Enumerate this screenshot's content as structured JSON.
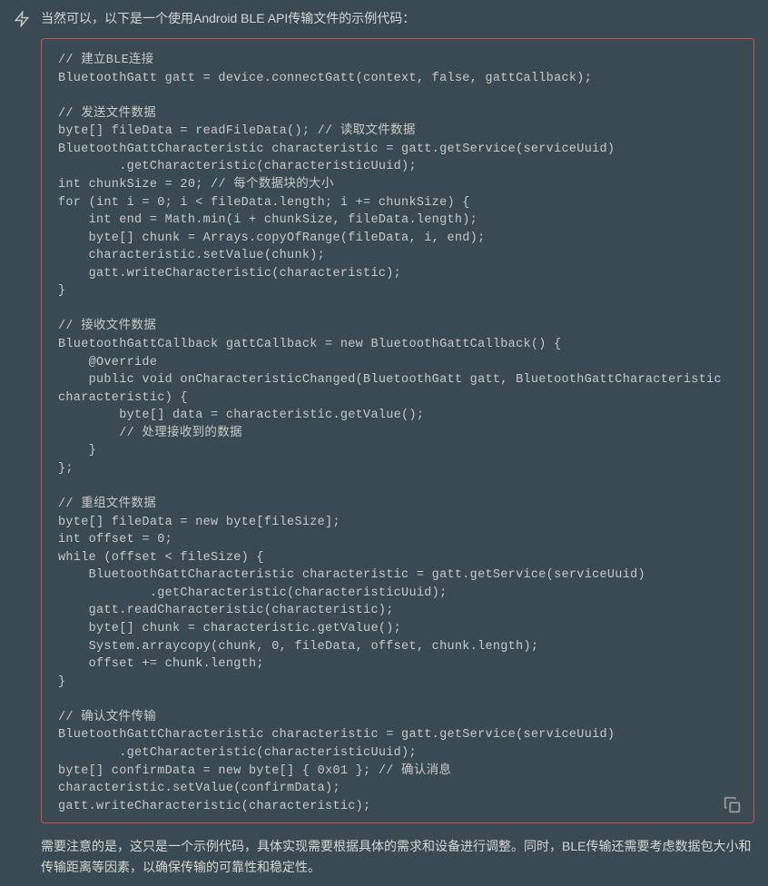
{
  "intro": "当然可以，以下是一个使用Android BLE API传输文件的示例代码：",
  "code": "// 建立BLE连接\nBluetoothGatt gatt = device.connectGatt(context, false, gattCallback);\n\n// 发送文件数据\nbyte[] fileData = readFileData(); // 读取文件数据\nBluetoothGattCharacteristic characteristic = gatt.getService(serviceUuid)\n        .getCharacteristic(characteristicUuid);\nint chunkSize = 20; // 每个数据块的大小\nfor (int i = 0; i < fileData.length; i += chunkSize) {\n    int end = Math.min(i + chunkSize, fileData.length);\n    byte[] chunk = Arrays.copyOfRange(fileData, i, end);\n    characteristic.setValue(chunk);\n    gatt.writeCharacteristic(characteristic);\n}\n\n// 接收文件数据\nBluetoothGattCallback gattCallback = new BluetoothGattCallback() {\n    @Override\n    public void onCharacteristicChanged(BluetoothGatt gatt, BluetoothGattCharacteristic\ncharacteristic) {\n        byte[] data = characteristic.getValue();\n        // 处理接收到的数据\n    }\n};\n\n// 重组文件数据\nbyte[] fileData = new byte[fileSize];\nint offset = 0;\nwhile (offset < fileSize) {\n    BluetoothGattCharacteristic characteristic = gatt.getService(serviceUuid)\n            .getCharacteristic(characteristicUuid);\n    gatt.readCharacteristic(characteristic);\n    byte[] chunk = characteristic.getValue();\n    System.arraycopy(chunk, 0, fileData, offset, chunk.length);\n    offset += chunk.length;\n}\n\n// 确认文件传输\nBluetoothGattCharacteristic characteristic = gatt.getService(serviceUuid)\n        .getCharacteristic(characteristicUuid);\nbyte[] confirmData = new byte[] { 0x01 }; // 确认消息\ncharacteristic.setValue(confirmData);\ngatt.writeCharacteristic(characteristic);",
  "outro": "需要注意的是，这只是一个示例代码，具体实现需要根据具体的需求和设备进行调整。同时，BLE传输还需要考虑数据包大小和传输距离等因素，以确保传输的可靠性和稳定性。"
}
